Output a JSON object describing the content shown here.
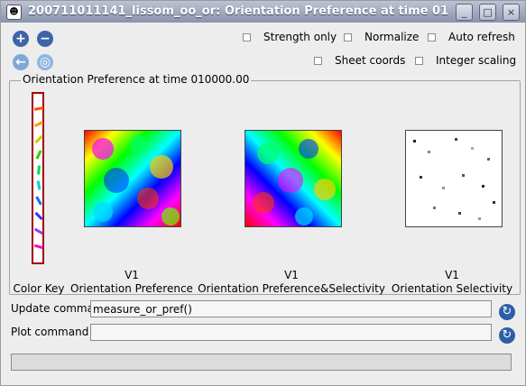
{
  "window": {
    "title": "200711011141_lissom_oo_or: Orientation Preference at time 01",
    "icon": "app-icon",
    "controls": {
      "minimize": "_",
      "maximize": "□",
      "close": "×"
    }
  },
  "toolbar": {
    "zoom_in_icon": "+",
    "zoom_out_icon": "−",
    "back_icon": "←",
    "forward_icon": "◎"
  },
  "options": {
    "strength_only": "Strength only",
    "normalize": "Normalize",
    "auto_refresh": "Auto refresh",
    "sheet_coords": "Sheet coords",
    "integer_scaling": "Integer scaling"
  },
  "panel": {
    "title": "Orientation Preference at time 010000.00",
    "plots": [
      {
        "line1": "",
        "line2": "Color Key"
      },
      {
        "line1": "V1",
        "line2": "Orientation Preference"
      },
      {
        "line1": "V1",
        "line2": "Orientation Preference&Selectivity"
      },
      {
        "line1": "V1",
        "line2": "Orientation Selectivity"
      }
    ]
  },
  "commands": {
    "update_label": "Update command",
    "update_value": "measure_or_pref()",
    "plot_label": "Plot command",
    "plot_value": "",
    "refresh_icon": "↻"
  }
}
